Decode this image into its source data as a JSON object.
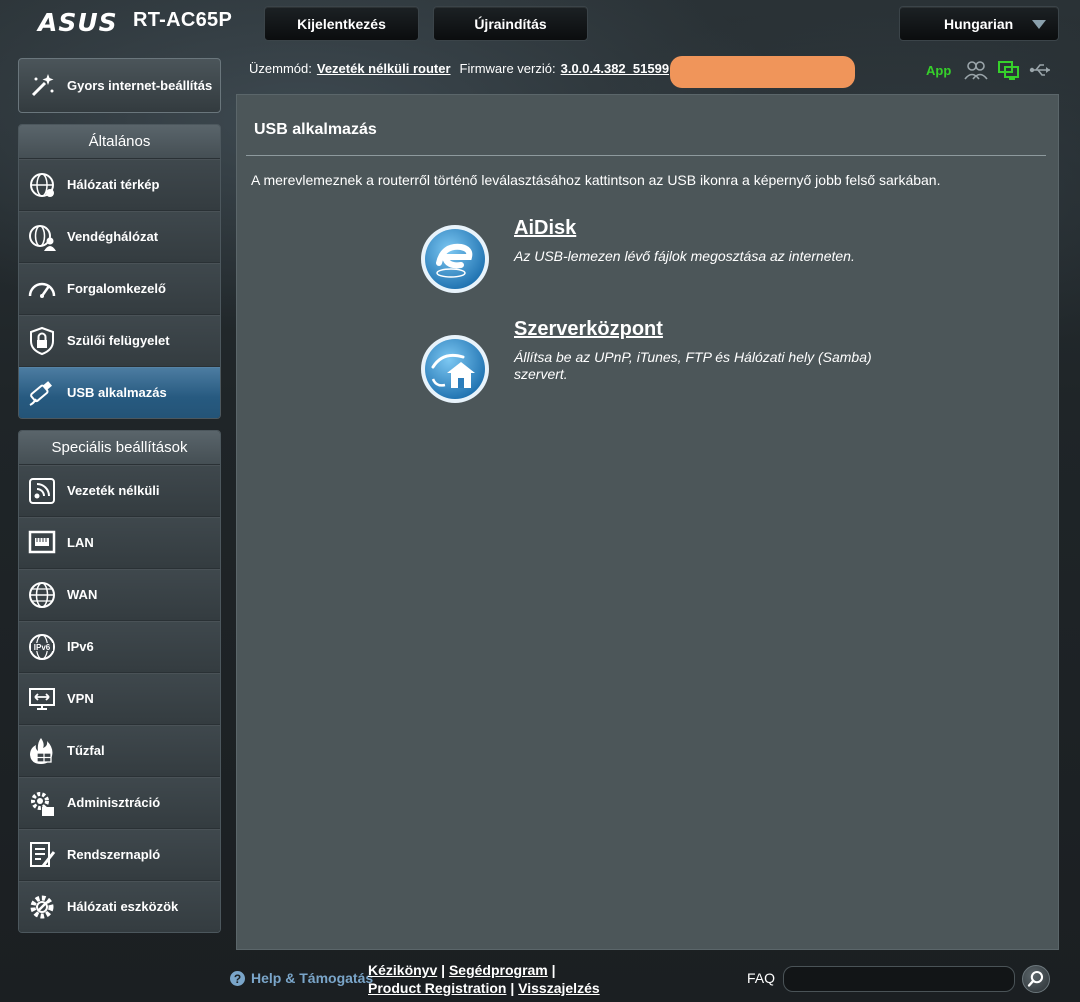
{
  "header": {
    "brand": "ASUS",
    "model": "RT-AC65P",
    "logout_label": "Kijelentkezés",
    "reboot_label": "Újraindítás",
    "language": "Hungarian"
  },
  "status": {
    "mode_label": "Üzemmód:",
    "mode_value": "Vezeték nélküli router",
    "firmware_label": "Firmware verzió:",
    "firmware_value": "3.0.0.4.382_51599",
    "app_label": "App"
  },
  "sidebar": {
    "quick_setup": "Gyors internet-beállítás",
    "general_title": "Általános",
    "general_items": [
      {
        "label": "Hálózati térkép",
        "icon": "globe-network-icon"
      },
      {
        "label": "Vendéghálózat",
        "icon": "guest-network-icon"
      },
      {
        "label": "Forgalomkezelő",
        "icon": "gauge-icon"
      },
      {
        "label": "Szülői felügyelet",
        "icon": "parental-lock-icon"
      },
      {
        "label": "USB alkalmazás",
        "icon": "usb-icon",
        "active": true
      }
    ],
    "advanced_title": "Speciális beállítások",
    "advanced_items": [
      {
        "label": "Vezeték nélküli",
        "icon": "wireless-icon"
      },
      {
        "label": "LAN",
        "icon": "lan-icon"
      },
      {
        "label": "WAN",
        "icon": "wan-globe-icon"
      },
      {
        "label": "IPv6",
        "icon": "ipv6-icon"
      },
      {
        "label": "VPN",
        "icon": "vpn-icon"
      },
      {
        "label": "Tűzfal",
        "icon": "firewall-icon"
      },
      {
        "label": "Adminisztráció",
        "icon": "admin-gear-icon"
      },
      {
        "label": "Rendszernapló",
        "icon": "system-log-icon"
      },
      {
        "label": "Hálózati eszközök",
        "icon": "network-tools-icon"
      }
    ]
  },
  "main": {
    "title": "USB alkalmazás",
    "description": "A merevlemeznek a routerről történő leválasztásához kattintson az USB ikonra a képernyő jobb felső sarkában.",
    "apps": [
      {
        "title": "AiDisk",
        "text": "Az USB-lemezen lévő fájlok megosztása az interneten.",
        "icon": "aidisk-icon"
      },
      {
        "title": "Szerverközpont",
        "text": "Állítsa be az UPnP, iTunes, FTP és Hálózati hely (Samba) szervert.",
        "icon": "server-center-icon"
      }
    ]
  },
  "footer": {
    "help_label": "Help & Támogatás",
    "links": [
      "Kézikönyv",
      "Segédprogram",
      "Product Registration",
      "Visszajelzés"
    ],
    "faq_label": "FAQ"
  },
  "colors": {
    "active_nav": "#275a80",
    "app_green": "#36d02b",
    "help_blue": "#7aa5c9",
    "panel": "#4c5659"
  }
}
